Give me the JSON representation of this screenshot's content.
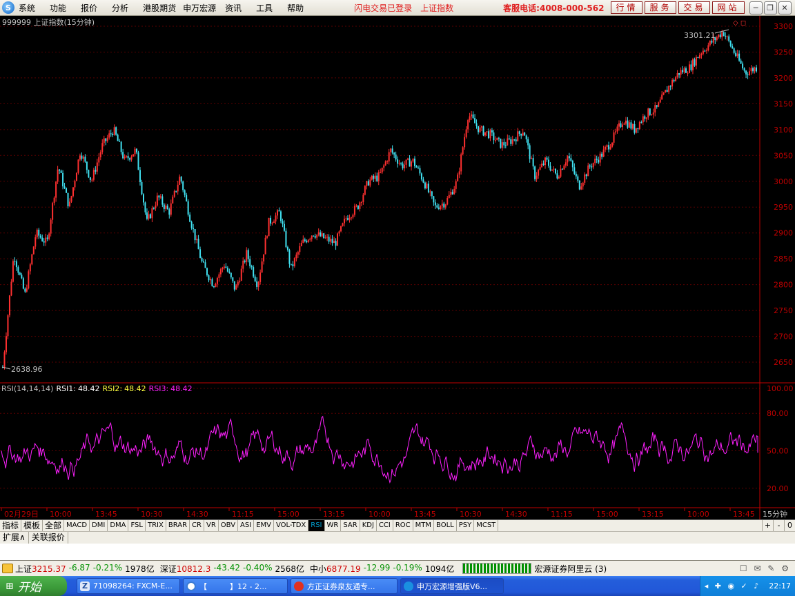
{
  "menubar": {
    "items": [
      "系统",
      "功能",
      "报价",
      "分析",
      "港股期货",
      "申万宏源",
      "资讯",
      "工具",
      "帮助"
    ],
    "status_login": "闪电交易已登录",
    "current_index": "上证指数",
    "hotline": "客服电话:4008-000-562",
    "service_buttons": [
      "行情",
      "服务",
      "交易",
      "网站"
    ]
  },
  "main_chart": {
    "code": "999999",
    "name": "上证指数",
    "period": "(15分钟)",
    "high_label": "3301.21",
    "low_label": "2638.96",
    "y_ticks": [
      "3300",
      "3250",
      "3200",
      "3150",
      "3100",
      "3050",
      "3000",
      "2950",
      "2900",
      "2850",
      "2800",
      "2750",
      "2700",
      "2650"
    ]
  },
  "rsi_panel": {
    "title": "RSI(14,14,14)",
    "rsi1_label": "RSI1:",
    "rsi1_value": "48.42",
    "rsi2_label": "RSI2:",
    "rsi2_value": "48.42",
    "rsi3_label": "RSI3:",
    "rsi3_value": "48.42",
    "y_ticks": [
      "100.00",
      "80.00",
      "50.00",
      "20.00"
    ]
  },
  "x_axis": {
    "labels": [
      "02月29日",
      "10:00",
      "13:45",
      "10:30",
      "14:30",
      "11:15",
      "15:00",
      "13:15",
      "10:00",
      "13:45",
      "10:30",
      "14:30",
      "11:15",
      "15:00",
      "13:15",
      "10:00",
      "13:45"
    ],
    "period": "15分钟"
  },
  "chart_data": {
    "type": "candlestick",
    "title": "999999 上证指数(15分钟)",
    "price_ylim": [
      2610,
      3320
    ],
    "highest": 3301.21,
    "lowest": 2638.96,
    "price_path": [
      2640,
      2860,
      2780,
      2900,
      2880,
      3030,
      2950,
      3060,
      3000,
      3070,
      3100,
      3040,
      3060,
      2920,
      2970,
      2940,
      3010,
      2920,
      2840,
      2800,
      2840,
      2790,
      2860,
      2800,
      2920,
      2940,
      2830,
      2880,
      2900,
      2890,
      2880,
      2930,
      2950,
      3000,
      3010,
      3060,
      3030,
      3040,
      3000,
      2950,
      2960,
      3000,
      3130,
      3100,
      3090,
      3070,
      3080,
      3100,
      3010,
      3040,
      3010,
      3050,
      2990,
      3030,
      3050,
      3080,
      3120,
      3100,
      3130,
      3140,
      3180,
      3210,
      3220,
      3250,
      3270,
      3290,
      3250,
      3210,
      3220
    ],
    "rsi": {
      "name": "RSI1",
      "ylim": [
        0,
        100
      ],
      "last": 48.42
    }
  },
  "indicator_tabs": [
    "指标",
    "模板",
    "全部",
    "MACD",
    "DMI",
    "DMA",
    "FSL",
    "TRIX",
    "BRAR",
    "CR",
    "VR",
    "OBV",
    "ASI",
    "EMV",
    "VOL-TDX",
    "RSI",
    "WR",
    "SAR",
    "KDJ",
    "CCI",
    "ROC",
    "MTM",
    "BOLL",
    "PSY",
    "MCST"
  ],
  "active_tab": "RSI",
  "sub_tabs": [
    "扩展∧",
    "关联报价"
  ],
  "status_bar": {
    "sh_label": "上证",
    "sh_value": "3215.37",
    "sh_change": "-6.87",
    "sh_pct": "-0.21%",
    "sh_amount": "1978亿",
    "sz_label": "深证",
    "sz_value": "10812.3",
    "sz_change": "-43.42",
    "sz_pct": "-0.40%",
    "sz_amount": "2568亿",
    "zx_label": "中小",
    "zx_value": "6877.19",
    "zx_change": "-12.99",
    "zx_pct": "-0.19%",
    "zx_amount": "1094亿",
    "server": "宏源证券阿里云 (3)"
  },
  "taskbar": {
    "start": "开始",
    "tasks": [
      "71098264: FXCM-E...",
      "【　　　】12 - 2...",
      "方正证券泉友通专...",
      "申万宏源增强版V6..."
    ],
    "clock": "22:17"
  },
  "colors": {
    "up": "#ff3030",
    "down": "#40e0f0",
    "grid": "#6b0000",
    "rsi": "#ff20ff",
    "axis": "#c00000"
  }
}
